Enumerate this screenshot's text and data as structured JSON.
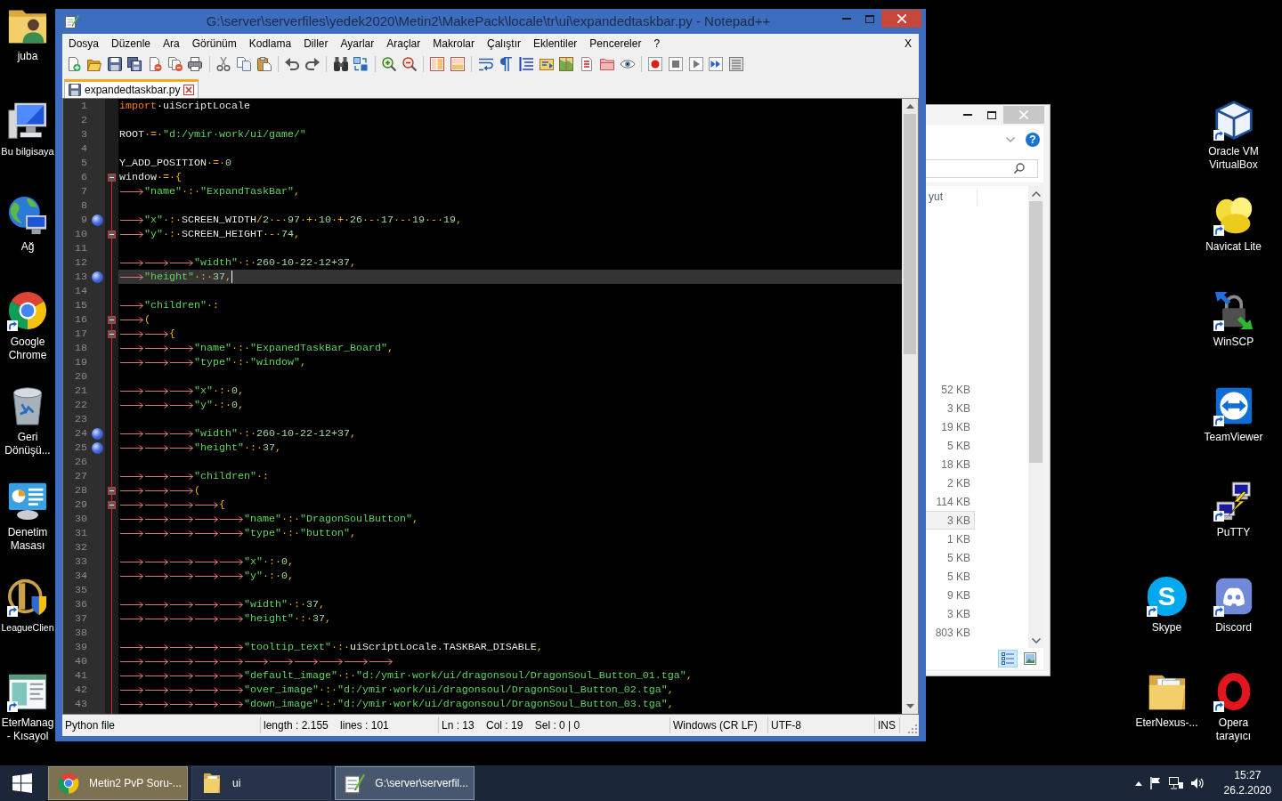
{
  "desktop_left": [
    {
      "label": "juba",
      "shortcut": false
    },
    {
      "label": "Bu bilgisaya",
      "shortcut": false
    },
    {
      "label": "Ağ",
      "shortcut": false
    },
    {
      "label": "Google\nChrome",
      "shortcut": true
    },
    {
      "label": "Geri\nDönüşü...",
      "shortcut": false
    },
    {
      "label": "Denetim\nMasası",
      "shortcut": false
    },
    {
      "label": "LeagueClien",
      "shortcut": true
    },
    {
      "label": "EterManag\n- Kısayol",
      "shortcut": true
    }
  ],
  "desktop_right": [
    {
      "label": "Oracle VM\nVirtualBox",
      "shortcut": true
    },
    {
      "label": "Navicat Lite",
      "shortcut": true
    },
    {
      "label": "WinSCP",
      "shortcut": true
    },
    {
      "label": "TeamViewer",
      "shortcut": true
    },
    {
      "label": "PuTTY",
      "shortcut": true
    },
    {
      "label": "Skype",
      "shortcut": true,
      "glyph": "S"
    },
    {
      "label": "Discord",
      "shortcut": true
    },
    {
      "label": "EterNexus-...",
      "shortcut": false
    },
    {
      "label": "Opera\ntarayıcı",
      "shortcut": true
    }
  ],
  "notepad": {
    "title": "G:\\server\\serverfiles\\yedek2020\\Metin2\\MakePack\\locale\\tr\\ui\\expandedtaskbar.py - Notepad++",
    "menu": [
      "Dosya",
      "Düzenle",
      "Ara",
      "Görünüm",
      "Kodlama",
      "Diller",
      "Ayarlar",
      "Araçlar",
      "Makrolar",
      "Çalıştır",
      "Eklentiler",
      "Pencereler",
      "?"
    ],
    "menu_close": "X",
    "tabs": [
      {
        "label": "expandedtaskbar.py",
        "selected": true
      }
    ],
    "editor": {
      "lines": [
        {
          "number": "1",
          "bookmark": false,
          "fold": false,
          "current": false,
          "tokens": [
            {
              "kind": "keyword",
              "text": "import"
            },
            {
              "kind": "name",
              "text": "·uiScriptLocale"
            }
          ]
        },
        {
          "number": "2",
          "bookmark": false,
          "fold": false,
          "current": false
        },
        {
          "number": "3",
          "bookmark": false,
          "fold": false,
          "current": false,
          "tokens": [
            {
              "kind": "name",
              "text": "ROOT"
            },
            {
              "kind": "operator",
              "text": "·=·"
            },
            {
              "kind": "string",
              "text": "\"d:/ymir·work/ui/game/\""
            }
          ]
        },
        {
          "number": "4",
          "bookmark": false,
          "fold": false,
          "current": false
        },
        {
          "number": "5",
          "bookmark": false,
          "fold": false,
          "current": false,
          "tokens": [
            {
              "kind": "name",
              "text": "Y_ADD_POSITION"
            },
            {
              "kind": "operator",
              "text": "·=·"
            },
            {
              "kind": "number",
              "text": "0"
            }
          ]
        },
        {
          "number": "6",
          "bookmark": false,
          "fold": true,
          "current": false,
          "tokens": [
            {
              "kind": "name",
              "text": "window"
            },
            {
              "kind": "operator",
              "text": "·=·{"
            }
          ]
        },
        {
          "number": "7",
          "bookmark": false,
          "fold": false,
          "current": false,
          "tokens": [
            {
              "kind": "tab"
            },
            {
              "kind": "string",
              "text": "\"name\""
            },
            {
              "kind": "operator",
              "text": "·:·"
            },
            {
              "kind": "string",
              "text": "\"ExpandTaskBar\""
            },
            {
              "kind": "operator",
              "text": ","
            }
          ]
        },
        {
          "number": "8",
          "bookmark": false,
          "fold": false,
          "current": false
        },
        {
          "number": "9",
          "bookmark": true,
          "fold": false,
          "current": false,
          "tokens": [
            {
              "kind": "tab"
            },
            {
              "kind": "string",
              "text": "\"x\""
            },
            {
              "kind": "operator",
              "text": "·:·"
            },
            {
              "kind": "name",
              "text": "SCREEN_WIDTH"
            },
            {
              "kind": "operator",
              "text": "/"
            },
            {
              "kind": "number",
              "text": "2"
            },
            {
              "kind": "operator",
              "text": "·-·"
            },
            {
              "kind": "number",
              "text": "97"
            },
            {
              "kind": "operator",
              "text": "·+·"
            },
            {
              "kind": "number",
              "text": "10"
            },
            {
              "kind": "operator",
              "text": "·+·"
            },
            {
              "kind": "number",
              "text": "26"
            },
            {
              "kind": "operator",
              "text": "·-·"
            },
            {
              "kind": "number",
              "text": "17"
            },
            {
              "kind": "operator",
              "text": "·-·"
            },
            {
              "kind": "number",
              "text": "19"
            },
            {
              "kind": "operator",
              "text": "·-·"
            },
            {
              "kind": "number",
              "text": "19"
            },
            {
              "kind": "operator",
              "text": ","
            }
          ]
        },
        {
          "number": "10",
          "bookmark": false,
          "fold": true,
          "current": false,
          "tokens": [
            {
              "kind": "tab"
            },
            {
              "kind": "string",
              "text": "\"y\""
            },
            {
              "kind": "operator",
              "text": "·:·"
            },
            {
              "kind": "name",
              "text": "SCREEN_HEIGHT"
            },
            {
              "kind": "operator",
              "text": "·-·"
            },
            {
              "kind": "number",
              "text": "74"
            },
            {
              "kind": "operator",
              "text": ","
            }
          ]
        },
        {
          "number": "11",
          "bookmark": false,
          "fold": false,
          "current": false
        },
        {
          "number": "12",
          "bookmark": false,
          "fold": false,
          "current": false,
          "tokens": [
            {
              "kind": "tab"
            },
            {
              "kind": "tab"
            },
            {
              "kind": "tab"
            },
            {
              "kind": "string",
              "text": "\"width\""
            },
            {
              "kind": "operator",
              "text": "·:·"
            },
            {
              "kind": "number",
              "text": "260-10-22-12+37"
            },
            {
              "kind": "operator",
              "text": ","
            }
          ]
        },
        {
          "number": "13",
          "bookmark": true,
          "fold": false,
          "current": true,
          "tokens": [
            {
              "kind": "tab"
            },
            {
              "kind": "string",
              "text": "\"height\""
            },
            {
              "kind": "operator",
              "text": "·:·"
            },
            {
              "kind": "number",
              "text": "37"
            },
            {
              "kind": "operator",
              "text": ","
            }
          ]
        },
        {
          "number": "14",
          "bookmark": false,
          "fold": false,
          "current": false
        },
        {
          "number": "15",
          "bookmark": false,
          "fold": false,
          "current": false,
          "tokens": [
            {
              "kind": "tab"
            },
            {
              "kind": "string",
              "text": "\"children\""
            },
            {
              "kind": "operator",
              "text": "·:"
            }
          ]
        },
        {
          "number": "16",
          "bookmark": false,
          "fold": true,
          "current": false,
          "tokens": [
            {
              "kind": "tab"
            },
            {
              "kind": "operator",
              "text": "("
            }
          ]
        },
        {
          "number": "17",
          "bookmark": false,
          "fold": true,
          "current": false,
          "tokens": [
            {
              "kind": "tab"
            },
            {
              "kind": "tab"
            },
            {
              "kind": "operator",
              "text": "{"
            }
          ]
        },
        {
          "number": "18",
          "bookmark": false,
          "fold": false,
          "current": false,
          "tokens": [
            {
              "kind": "tab"
            },
            {
              "kind": "tab"
            },
            {
              "kind": "tab"
            },
            {
              "kind": "string",
              "text": "\"name\""
            },
            {
              "kind": "operator",
              "text": "·:·"
            },
            {
              "kind": "string",
              "text": "\"ExpanedTaskBar_Board\""
            },
            {
              "kind": "operator",
              "text": ","
            }
          ]
        },
        {
          "number": "19",
          "bookmark": false,
          "fold": false,
          "current": false,
          "tokens": [
            {
              "kind": "tab"
            },
            {
              "kind": "tab"
            },
            {
              "kind": "tab"
            },
            {
              "kind": "string",
              "text": "\"type\""
            },
            {
              "kind": "operator",
              "text": "·:·"
            },
            {
              "kind": "string",
              "text": "\"window\""
            },
            {
              "kind": "operator",
              "text": ","
            }
          ]
        },
        {
          "number": "20",
          "bookmark": false,
          "fold": false,
          "current": false
        },
        {
          "number": "21",
          "bookmark": false,
          "fold": false,
          "current": false,
          "tokens": [
            {
              "kind": "tab"
            },
            {
              "kind": "tab"
            },
            {
              "kind": "tab"
            },
            {
              "kind": "string",
              "text": "\"x\""
            },
            {
              "kind": "operator",
              "text": "·:·"
            },
            {
              "kind": "number",
              "text": "0"
            },
            {
              "kind": "operator",
              "text": ","
            }
          ]
        },
        {
          "number": "22",
          "bookmark": false,
          "fold": false,
          "current": false,
          "tokens": [
            {
              "kind": "tab"
            },
            {
              "kind": "tab"
            },
            {
              "kind": "tab"
            },
            {
              "kind": "string",
              "text": "\"y\""
            },
            {
              "kind": "operator",
              "text": "·:·"
            },
            {
              "kind": "number",
              "text": "0"
            },
            {
              "kind": "operator",
              "text": ","
            }
          ]
        },
        {
          "number": "23",
          "bookmark": false,
          "fold": false,
          "current": false
        },
        {
          "number": "24",
          "bookmark": true,
          "fold": false,
          "current": false,
          "tokens": [
            {
              "kind": "tab"
            },
            {
              "kind": "tab"
            },
            {
              "kind": "tab"
            },
            {
              "kind": "string",
              "text": "\"width\""
            },
            {
              "kind": "operator",
              "text": "·:·"
            },
            {
              "kind": "number",
              "text": "260-10-22-12+37"
            },
            {
              "kind": "operator",
              "text": ","
            }
          ]
        },
        {
          "number": "25",
          "bookmark": true,
          "fold": false,
          "current": false,
          "tokens": [
            {
              "kind": "tab"
            },
            {
              "kind": "tab"
            },
            {
              "kind": "tab"
            },
            {
              "kind": "string",
              "text": "\"height\""
            },
            {
              "kind": "operator",
              "text": "·:·"
            },
            {
              "kind": "number",
              "text": "37"
            },
            {
              "kind": "operator",
              "text": ","
            }
          ]
        },
        {
          "number": "26",
          "bookmark": false,
          "fold": false,
          "current": false
        },
        {
          "number": "27",
          "bookmark": false,
          "fold": false,
          "current": false,
          "tokens": [
            {
              "kind": "tab"
            },
            {
              "kind": "tab"
            },
            {
              "kind": "tab"
            },
            {
              "kind": "string",
              "text": "\"children\""
            },
            {
              "kind": "operator",
              "text": "·:"
            }
          ]
        },
        {
          "number": "28",
          "bookmark": false,
          "fold": true,
          "current": false,
          "tokens": [
            {
              "kind": "tab"
            },
            {
              "kind": "tab"
            },
            {
              "kind": "tab"
            },
            {
              "kind": "operator",
              "text": "("
            }
          ]
        },
        {
          "number": "29",
          "bookmark": false,
          "fold": true,
          "current": false,
          "tokens": [
            {
              "kind": "tab"
            },
            {
              "kind": "tab"
            },
            {
              "kind": "tab"
            },
            {
              "kind": "tab"
            },
            {
              "kind": "operator",
              "text": "{"
            }
          ]
        },
        {
          "number": "30",
          "bookmark": false,
          "fold": false,
          "current": false,
          "tokens": [
            {
              "kind": "tab"
            },
            {
              "kind": "tab"
            },
            {
              "kind": "tab"
            },
            {
              "kind": "tab"
            },
            {
              "kind": "tab"
            },
            {
              "kind": "string",
              "text": "\"name\""
            },
            {
              "kind": "operator",
              "text": "·:·"
            },
            {
              "kind": "string",
              "text": "\"DragonSoulButton\""
            },
            {
              "kind": "operator",
              "text": ","
            }
          ]
        },
        {
          "number": "31",
          "bookmark": false,
          "fold": false,
          "current": false,
          "tokens": [
            {
              "kind": "tab"
            },
            {
              "kind": "tab"
            },
            {
              "kind": "tab"
            },
            {
              "kind": "tab"
            },
            {
              "kind": "tab"
            },
            {
              "kind": "string",
              "text": "\"type\""
            },
            {
              "kind": "operator",
              "text": "·:·"
            },
            {
              "kind": "string",
              "text": "\"button\""
            },
            {
              "kind": "operator",
              "text": ","
            }
          ]
        },
        {
          "number": "32",
          "bookmark": false,
          "fold": false,
          "current": false
        },
        {
          "number": "33",
          "bookmark": false,
          "fold": false,
          "current": false,
          "tokens": [
            {
              "kind": "tab"
            },
            {
              "kind": "tab"
            },
            {
              "kind": "tab"
            },
            {
              "kind": "tab"
            },
            {
              "kind": "tab"
            },
            {
              "kind": "string",
              "text": "\"x\""
            },
            {
              "kind": "operator",
              "text": "·:·"
            },
            {
              "kind": "number",
              "text": "0"
            },
            {
              "kind": "operator",
              "text": ","
            }
          ]
        },
        {
          "number": "34",
          "bookmark": false,
          "fold": false,
          "current": false,
          "tokens": [
            {
              "kind": "tab"
            },
            {
              "kind": "tab"
            },
            {
              "kind": "tab"
            },
            {
              "kind": "tab"
            },
            {
              "kind": "tab"
            },
            {
              "kind": "string",
              "text": "\"y\""
            },
            {
              "kind": "operator",
              "text": "·:·"
            },
            {
              "kind": "number",
              "text": "0"
            },
            {
              "kind": "operator",
              "text": ","
            }
          ]
        },
        {
          "number": "35",
          "bookmark": false,
          "fold": false,
          "current": false
        },
        {
          "number": "36",
          "bookmark": false,
          "fold": false,
          "current": false,
          "tokens": [
            {
              "kind": "tab"
            },
            {
              "kind": "tab"
            },
            {
              "kind": "tab"
            },
            {
              "kind": "tab"
            },
            {
              "kind": "tab"
            },
            {
              "kind": "string",
              "text": "\"width\""
            },
            {
              "kind": "operator",
              "text": "·:·"
            },
            {
              "kind": "number",
              "text": "37"
            },
            {
              "kind": "operator",
              "text": ","
            }
          ]
        },
        {
          "number": "37",
          "bookmark": false,
          "fold": false,
          "current": false,
          "tokens": [
            {
              "kind": "tab"
            },
            {
              "kind": "tab"
            },
            {
              "kind": "tab"
            },
            {
              "kind": "tab"
            },
            {
              "kind": "tab"
            },
            {
              "kind": "string",
              "text": "\"height\""
            },
            {
              "kind": "operator",
              "text": "·:·"
            },
            {
              "kind": "number",
              "text": "37"
            },
            {
              "kind": "operator",
              "text": ","
            }
          ]
        },
        {
          "number": "38",
          "bookmark": false,
          "fold": false,
          "current": false
        },
        {
          "number": "39",
          "bookmark": false,
          "fold": false,
          "current": false,
          "tokens": [
            {
              "kind": "tab"
            },
            {
              "kind": "tab"
            },
            {
              "kind": "tab"
            },
            {
              "kind": "tab"
            },
            {
              "kind": "tab"
            },
            {
              "kind": "string",
              "text": "\"tooltip_text\""
            },
            {
              "kind": "operator",
              "text": "·:·"
            },
            {
              "kind": "name",
              "text": "uiScriptLocale.TASKBAR_DISABLE"
            },
            {
              "kind": "operator",
              "text": ","
            }
          ]
        },
        {
          "number": "40",
          "bookmark": false,
          "fold": false,
          "current": false,
          "tokens": [
            {
              "kind": "tab"
            },
            {
              "kind": "tab"
            },
            {
              "kind": "tab"
            },
            {
              "kind": "tab"
            },
            {
              "kind": "tab"
            },
            {
              "kind": "tab"
            },
            {
              "kind": "tab"
            },
            {
              "kind": "tab"
            },
            {
              "kind": "tab"
            },
            {
              "kind": "tab"
            },
            {
              "kind": "tab"
            }
          ]
        },
        {
          "number": "41",
          "bookmark": false,
          "fold": false,
          "current": false,
          "tokens": [
            {
              "kind": "tab"
            },
            {
              "kind": "tab"
            },
            {
              "kind": "tab"
            },
            {
              "kind": "tab"
            },
            {
              "kind": "tab"
            },
            {
              "kind": "string",
              "text": "\"default_image\""
            },
            {
              "kind": "operator",
              "text": "·:·"
            },
            {
              "kind": "string",
              "text": "\"d:/ymir·work/ui/dragonsoul/DragonSoul_Button_01.tga\""
            },
            {
              "kind": "operator",
              "text": ","
            }
          ]
        },
        {
          "number": "42",
          "bookmark": false,
          "fold": false,
          "current": false,
          "tokens": [
            {
              "kind": "tab"
            },
            {
              "kind": "tab"
            },
            {
              "kind": "tab"
            },
            {
              "kind": "tab"
            },
            {
              "kind": "tab"
            },
            {
              "kind": "string",
              "text": "\"over_image\""
            },
            {
              "kind": "operator",
              "text": "·:·"
            },
            {
              "kind": "string",
              "text": "\"d:/ymir·work/ui/dragonsoul/DragonSoul_Button_02.tga\""
            },
            {
              "kind": "operator",
              "text": ","
            }
          ]
        },
        {
          "number": "43",
          "bookmark": false,
          "fold": false,
          "current": false,
          "tokens": [
            {
              "kind": "tab"
            },
            {
              "kind": "tab"
            },
            {
              "kind": "tab"
            },
            {
              "kind": "tab"
            },
            {
              "kind": "tab"
            },
            {
              "kind": "string",
              "text": "\"down_image\""
            },
            {
              "kind": "operator",
              "text": "·:·"
            },
            {
              "kind": "string",
              "text": "\"d:/ymir·work/ui/dragonsoul/DragonSoul_Button_03.tga\""
            },
            {
              "kind": "operator",
              "text": ","
            }
          ]
        }
      ]
    },
    "status_bar": [
      "Python file",
      "length : 2.155    lines : 101",
      "Ln : 13    Col : 19    Sel : 0 | 0",
      "Windows (CR LF)",
      "UTF-8",
      "INS"
    ]
  },
  "explorer": {
    "help": "?",
    "column_header": "yut",
    "rows": [
      {
        "size": "52 KB",
        "selected": false
      },
      {
        "size": "3 KB",
        "selected": false
      },
      {
        "size": "19 KB",
        "selected": false
      },
      {
        "size": "5 KB",
        "selected": false
      },
      {
        "size": "18 KB",
        "selected": false
      },
      {
        "size": "2 KB",
        "selected": false
      },
      {
        "size": "114 KB",
        "selected": false
      },
      {
        "size": "3 KB",
        "selected": true
      },
      {
        "size": "1 KB",
        "selected": false
      },
      {
        "size": "5 KB",
        "selected": false
      },
      {
        "size": "5 KB",
        "selected": false
      },
      {
        "size": "9 KB",
        "selected": false
      },
      {
        "size": "3 KB",
        "selected": false
      },
      {
        "size": "803 KB",
        "selected": false
      }
    ],
    "views": [
      {
        "selected": true
      },
      {
        "selected": false
      }
    ]
  },
  "taskbar": {
    "buttons": [
      {
        "label": "Metin2 PvP Soru-...",
        "flashing": true,
        "selected": false
      },
      {
        "label": "ui",
        "flashing": false,
        "selected": false
      },
      {
        "label": "G:\\server\\serverfil...",
        "flashing": false,
        "selected": true
      }
    ],
    "time": "15:27",
    "date": "26.2.2020"
  }
}
